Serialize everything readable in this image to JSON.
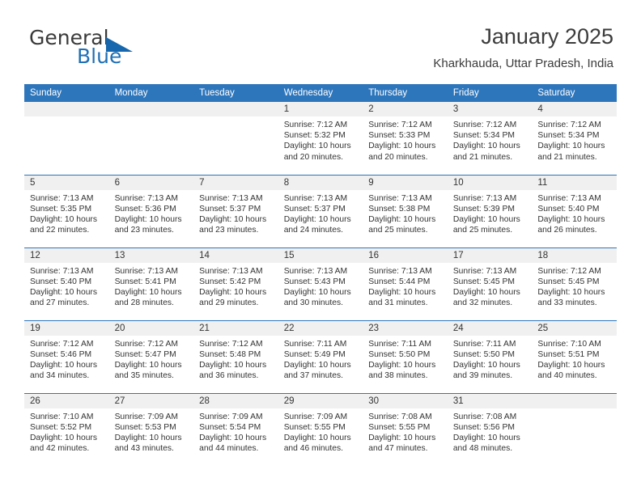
{
  "brand": {
    "name_part1": "General",
    "name_part2": "Blue",
    "triangle_icon": "triangle-icon",
    "accent_color": "#1667ad"
  },
  "header": {
    "title": "January 2025",
    "location": "Kharkhauda, Uttar Pradesh, India",
    "header_bg_color": "#2e76bc",
    "daynum_bg_color": "#f0f0f0"
  },
  "weekday_headers": [
    "Sunday",
    "Monday",
    "Tuesday",
    "Wednesday",
    "Thursday",
    "Friday",
    "Saturday"
  ],
  "labels": {
    "sunrise_prefix": "Sunrise:",
    "sunset_prefix": "Sunset:",
    "daylight_prefix": "Daylight:"
  },
  "weeks": [
    [
      {
        "day": "",
        "empty": true
      },
      {
        "day": "",
        "empty": true
      },
      {
        "day": "",
        "empty": true
      },
      {
        "day": "1",
        "sunrise": "Sunrise: 7:12 AM",
        "sunset": "Sunset: 5:32 PM",
        "daylight_line1": "Daylight: 10 hours",
        "daylight_line2": "and 20 minutes."
      },
      {
        "day": "2",
        "sunrise": "Sunrise: 7:12 AM",
        "sunset": "Sunset: 5:33 PM",
        "daylight_line1": "Daylight: 10 hours",
        "daylight_line2": "and 20 minutes."
      },
      {
        "day": "3",
        "sunrise": "Sunrise: 7:12 AM",
        "sunset": "Sunset: 5:34 PM",
        "daylight_line1": "Daylight: 10 hours",
        "daylight_line2": "and 21 minutes."
      },
      {
        "day": "4",
        "sunrise": "Sunrise: 7:12 AM",
        "sunset": "Sunset: 5:34 PM",
        "daylight_line1": "Daylight: 10 hours",
        "daylight_line2": "and 21 minutes."
      }
    ],
    [
      {
        "day": "5",
        "sunrise": "Sunrise: 7:13 AM",
        "sunset": "Sunset: 5:35 PM",
        "daylight_line1": "Daylight: 10 hours",
        "daylight_line2": "and 22 minutes."
      },
      {
        "day": "6",
        "sunrise": "Sunrise: 7:13 AM",
        "sunset": "Sunset: 5:36 PM",
        "daylight_line1": "Daylight: 10 hours",
        "daylight_line2": "and 23 minutes."
      },
      {
        "day": "7",
        "sunrise": "Sunrise: 7:13 AM",
        "sunset": "Sunset: 5:37 PM",
        "daylight_line1": "Daylight: 10 hours",
        "daylight_line2": "and 23 minutes."
      },
      {
        "day": "8",
        "sunrise": "Sunrise: 7:13 AM",
        "sunset": "Sunset: 5:37 PM",
        "daylight_line1": "Daylight: 10 hours",
        "daylight_line2": "and 24 minutes."
      },
      {
        "day": "9",
        "sunrise": "Sunrise: 7:13 AM",
        "sunset": "Sunset: 5:38 PM",
        "daylight_line1": "Daylight: 10 hours",
        "daylight_line2": "and 25 minutes."
      },
      {
        "day": "10",
        "sunrise": "Sunrise: 7:13 AM",
        "sunset": "Sunset: 5:39 PM",
        "daylight_line1": "Daylight: 10 hours",
        "daylight_line2": "and 25 minutes."
      },
      {
        "day": "11",
        "sunrise": "Sunrise: 7:13 AM",
        "sunset": "Sunset: 5:40 PM",
        "daylight_line1": "Daylight: 10 hours",
        "daylight_line2": "and 26 minutes."
      }
    ],
    [
      {
        "day": "12",
        "sunrise": "Sunrise: 7:13 AM",
        "sunset": "Sunset: 5:40 PM",
        "daylight_line1": "Daylight: 10 hours",
        "daylight_line2": "and 27 minutes."
      },
      {
        "day": "13",
        "sunrise": "Sunrise: 7:13 AM",
        "sunset": "Sunset: 5:41 PM",
        "daylight_line1": "Daylight: 10 hours",
        "daylight_line2": "and 28 minutes."
      },
      {
        "day": "14",
        "sunrise": "Sunrise: 7:13 AM",
        "sunset": "Sunset: 5:42 PM",
        "daylight_line1": "Daylight: 10 hours",
        "daylight_line2": "and 29 minutes."
      },
      {
        "day": "15",
        "sunrise": "Sunrise: 7:13 AM",
        "sunset": "Sunset: 5:43 PM",
        "daylight_line1": "Daylight: 10 hours",
        "daylight_line2": "and 30 minutes."
      },
      {
        "day": "16",
        "sunrise": "Sunrise: 7:13 AM",
        "sunset": "Sunset: 5:44 PM",
        "daylight_line1": "Daylight: 10 hours",
        "daylight_line2": "and 31 minutes."
      },
      {
        "day": "17",
        "sunrise": "Sunrise: 7:13 AM",
        "sunset": "Sunset: 5:45 PM",
        "daylight_line1": "Daylight: 10 hours",
        "daylight_line2": "and 32 minutes."
      },
      {
        "day": "18",
        "sunrise": "Sunrise: 7:12 AM",
        "sunset": "Sunset: 5:45 PM",
        "daylight_line1": "Daylight: 10 hours",
        "daylight_line2": "and 33 minutes."
      }
    ],
    [
      {
        "day": "19",
        "sunrise": "Sunrise: 7:12 AM",
        "sunset": "Sunset: 5:46 PM",
        "daylight_line1": "Daylight: 10 hours",
        "daylight_line2": "and 34 minutes."
      },
      {
        "day": "20",
        "sunrise": "Sunrise: 7:12 AM",
        "sunset": "Sunset: 5:47 PM",
        "daylight_line1": "Daylight: 10 hours",
        "daylight_line2": "and 35 minutes."
      },
      {
        "day": "21",
        "sunrise": "Sunrise: 7:12 AM",
        "sunset": "Sunset: 5:48 PM",
        "daylight_line1": "Daylight: 10 hours",
        "daylight_line2": "and 36 minutes."
      },
      {
        "day": "22",
        "sunrise": "Sunrise: 7:11 AM",
        "sunset": "Sunset: 5:49 PM",
        "daylight_line1": "Daylight: 10 hours",
        "daylight_line2": "and 37 minutes."
      },
      {
        "day": "23",
        "sunrise": "Sunrise: 7:11 AM",
        "sunset": "Sunset: 5:50 PM",
        "daylight_line1": "Daylight: 10 hours",
        "daylight_line2": "and 38 minutes."
      },
      {
        "day": "24",
        "sunrise": "Sunrise: 7:11 AM",
        "sunset": "Sunset: 5:50 PM",
        "daylight_line1": "Daylight: 10 hours",
        "daylight_line2": "and 39 minutes."
      },
      {
        "day": "25",
        "sunrise": "Sunrise: 7:10 AM",
        "sunset": "Sunset: 5:51 PM",
        "daylight_line1": "Daylight: 10 hours",
        "daylight_line2": "and 40 minutes."
      }
    ],
    [
      {
        "day": "26",
        "sunrise": "Sunrise: 7:10 AM",
        "sunset": "Sunset: 5:52 PM",
        "daylight_line1": "Daylight: 10 hours",
        "daylight_line2": "and 42 minutes."
      },
      {
        "day": "27",
        "sunrise": "Sunrise: 7:09 AM",
        "sunset": "Sunset: 5:53 PM",
        "daylight_line1": "Daylight: 10 hours",
        "daylight_line2": "and 43 minutes."
      },
      {
        "day": "28",
        "sunrise": "Sunrise: 7:09 AM",
        "sunset": "Sunset: 5:54 PM",
        "daylight_line1": "Daylight: 10 hours",
        "daylight_line2": "and 44 minutes."
      },
      {
        "day": "29",
        "sunrise": "Sunrise: 7:09 AM",
        "sunset": "Sunset: 5:55 PM",
        "daylight_line1": "Daylight: 10 hours",
        "daylight_line2": "and 46 minutes."
      },
      {
        "day": "30",
        "sunrise": "Sunrise: 7:08 AM",
        "sunset": "Sunset: 5:55 PM",
        "daylight_line1": "Daylight: 10 hours",
        "daylight_line2": "and 47 minutes."
      },
      {
        "day": "31",
        "sunrise": "Sunrise: 7:08 AM",
        "sunset": "Sunset: 5:56 PM",
        "daylight_line1": "Daylight: 10 hours",
        "daylight_line2": "and 48 minutes."
      },
      {
        "day": "",
        "empty": true
      }
    ]
  ]
}
